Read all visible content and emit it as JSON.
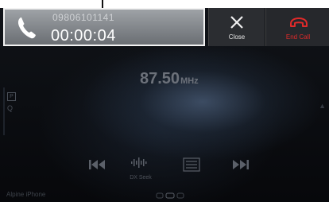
{
  "call": {
    "number": "09806101141",
    "duration": "00:00:04"
  },
  "buttons": {
    "close_label": "Close",
    "end_call_label": "End Call"
  },
  "radio": {
    "frequency": "87.50",
    "unit": "MHz",
    "dx_seek_label": "DX Seek",
    "preset_label": "P",
    "search_label": "Q"
  },
  "device": {
    "name": "Alpine iPhone"
  },
  "colors": {
    "end_call": "#e02a2a",
    "panel_border": "#f2f2f2"
  },
  "icons": {
    "phone": "phone-handset-icon",
    "close": "close-x-icon",
    "end_call": "hang-up-icon",
    "rewind": "skip-back-icon",
    "forward": "skip-forward-icon",
    "dx_seek": "dx-seek-icon",
    "list": "list-icon"
  }
}
